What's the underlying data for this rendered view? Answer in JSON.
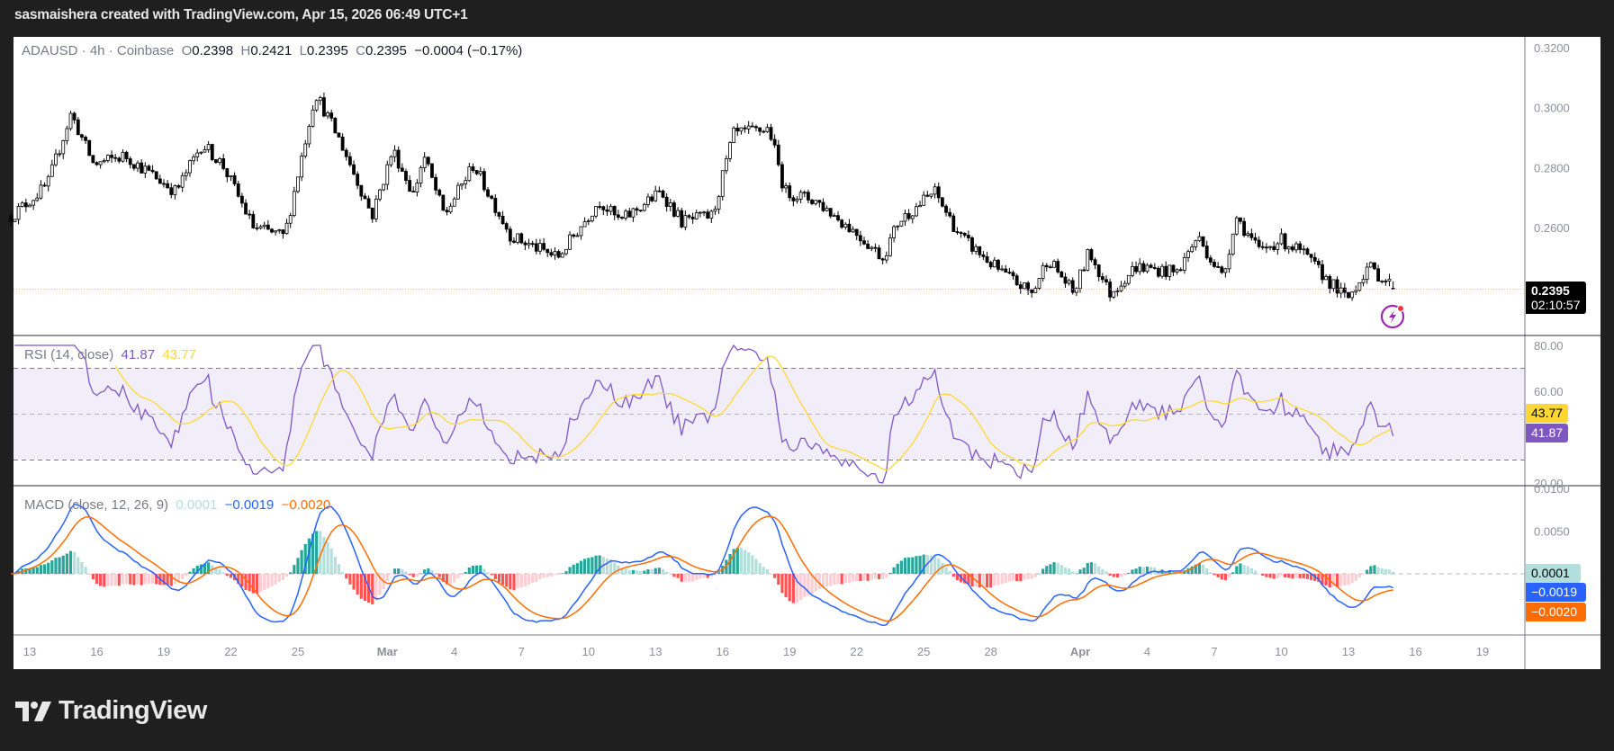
{
  "topbar": {
    "credit": "sasmaishera created with TradingView.com, Apr 15, 2026 06:49 UTC+1"
  },
  "legend": {
    "symbol": "ADAUSD · 4h · Coinbase",
    "o_label": "O",
    "o": "0.2398",
    "h_label": "H",
    "h": "0.2421",
    "l_label": "L",
    "l": "0.2395",
    "c_label": "C",
    "c": "0.2395",
    "change": "−0.0004 (−0.17%)",
    "rsi_title": "RSI (14, close)",
    "rsi_value": "41.87",
    "rsi_ma": "43.77",
    "macd_title": "MACD (close, 12, 26, 9)",
    "macd_hist": "0.0001",
    "macd_line": "−0.0019",
    "macd_signal": "−0.0020"
  },
  "badges": {
    "price": "0.2395",
    "countdown": "02:10:57",
    "rsi_ma": "43.77",
    "rsi": "41.87",
    "hist": "0.0001",
    "macd": "−0.0019",
    "signal": "−0.0020"
  },
  "logo": {
    "text": "TradingView"
  },
  "colors": {
    "up": "#ffffff",
    "down": "#000000",
    "rsi": "#7e57c2",
    "rsi_ma": "#fdd835",
    "macd": "#2962ff",
    "signal": "#ff6d00",
    "hist_up_strong": "#26a69a",
    "hist_up_weak": "#b2dfdb",
    "hist_dn_strong": "#ff5252",
    "hist_dn_weak": "#ffcdd2"
  },
  "chart_data": {
    "type": "candlestick",
    "symbol": "ADAUSD",
    "interval": "4h",
    "exchange": "Coinbase",
    "price_axis": {
      "ticks": [
        "0.3200",
        "0.3000",
        "0.2800",
        "0.2600"
      ],
      "tick_values": [
        0.32,
        0.3,
        0.28,
        0.26
      ],
      "range": [
        0.2275,
        0.3245
      ]
    },
    "rsi_axis": {
      "ticks": [
        "80.00",
        "60.00",
        "20.00"
      ],
      "tick_values": [
        80,
        60,
        20
      ],
      "bands": [
        70,
        50,
        30
      ],
      "range": [
        20,
        80
      ]
    },
    "macd_axis": {
      "ticks": [
        "0.0100",
        "0.0050"
      ],
      "tick_values": [
        0.01,
        0.005
      ],
      "zero": 0
    },
    "time_axis": {
      "ticks": [
        "13",
        "16",
        "19",
        "22",
        "25",
        "Mar",
        "4",
        "7",
        "10",
        "13",
        "16",
        "19",
        "22",
        "25",
        "28",
        "Apr",
        "4",
        "7",
        "10",
        "13",
        "16",
        "19"
      ],
      "tick_days": [
        0,
        3,
        6,
        9,
        12,
        16,
        19,
        22,
        25,
        28,
        31,
        34,
        37,
        40,
        43,
        47,
        50,
        53,
        56,
        59,
        62,
        65
      ]
    },
    "start_date": "Feb 13",
    "close_path_day_price": [
      [
        -0.8,
        0.264
      ],
      [
        0.78,
        0.274
      ],
      [
        1.85,
        0.298
      ],
      [
        2.86,
        0.281
      ],
      [
        4.25,
        0.284
      ],
      [
        6.55,
        0.272
      ],
      [
        7.71,
        0.288
      ],
      [
        8.63,
        0.281
      ],
      [
        10.02,
        0.26
      ],
      [
        11.4,
        0.257
      ],
      [
        12.78,
        0.305
      ],
      [
        13.94,
        0.288
      ],
      [
        15.32,
        0.264
      ],
      [
        16.25,
        0.286
      ],
      [
        17.17,
        0.271
      ],
      [
        17.63,
        0.284
      ],
      [
        18.55,
        0.264
      ],
      [
        19.85,
        0.281
      ],
      [
        21.55,
        0.257
      ],
      [
        23.63,
        0.25
      ],
      [
        25.48,
        0.269
      ],
      [
        26.4,
        0.262
      ],
      [
        28.25,
        0.272
      ],
      [
        29.17,
        0.262
      ],
      [
        30.55,
        0.264
      ],
      [
        31.48,
        0.291
      ],
      [
        33.09,
        0.293
      ],
      [
        33.78,
        0.272
      ],
      [
        35.17,
        0.269
      ],
      [
        37.02,
        0.258
      ],
      [
        38.17,
        0.25
      ],
      [
        38.86,
        0.262
      ],
      [
        40.48,
        0.272
      ],
      [
        41.63,
        0.257
      ],
      [
        43.48,
        0.245
      ],
      [
        44.86,
        0.238
      ],
      [
        45.55,
        0.25
      ],
      [
        46.71,
        0.238
      ],
      [
        47.4,
        0.252
      ],
      [
        48.32,
        0.238
      ],
      [
        49.48,
        0.247
      ],
      [
        51.32,
        0.245
      ],
      [
        52.25,
        0.257
      ],
      [
        53.4,
        0.243
      ],
      [
        53.95,
        0.264
      ],
      [
        55.02,
        0.252
      ],
      [
        55.94,
        0.256
      ],
      [
        56.86,
        0.252
      ],
      [
        58.02,
        0.243
      ],
      [
        58.94,
        0.236
      ],
      [
        59.86,
        0.247
      ],
      [
        61.17,
        0.2395
      ]
    ],
    "last_candle": {
      "open": 0.2398,
      "high": 0.2421,
      "low": 0.2395,
      "close": 0.2395
    },
    "rsi": {
      "value": 41.87,
      "ma": 43.77
    },
    "macd": {
      "hist": 0.0001,
      "macd": -0.0019,
      "signal": -0.002
    }
  }
}
